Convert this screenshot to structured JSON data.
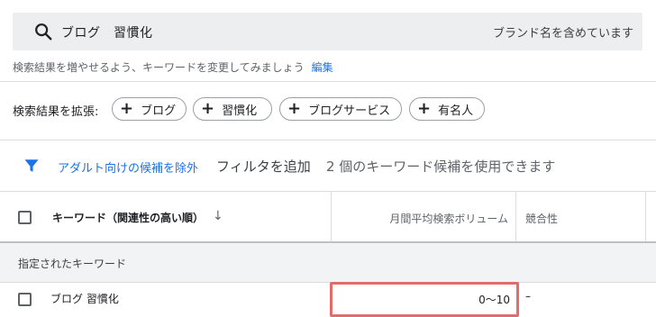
{
  "search": {
    "query": "ブログ　習慣化",
    "brand_note": "ブランド名を含めています",
    "hint": "検索結果を増やせるよう、キーワードを変更してみましょう",
    "hint_link": "編集"
  },
  "expand": {
    "label": "検索結果を拡張:",
    "chips": [
      "ブログ",
      "習慣化",
      "ブログサービス",
      "有名人"
    ]
  },
  "filter": {
    "adult_filter": "アダルト向けの候補を除外",
    "add_filter": "フィルタを追加",
    "count_text": "2 個のキーワード候補を使用できます"
  },
  "table": {
    "headers": {
      "keyword": "キーワード（関連性の高い順）",
      "volume": "月間平均検索ボリューム",
      "competition": "競合性"
    },
    "sort_icon": "arrow-down-icon",
    "section_label": "指定されたキーワード",
    "rows": [
      {
        "keyword": "ブログ 習慣化",
        "volume": "0～10",
        "competition": "–"
      }
    ]
  },
  "colors": {
    "link": "#1a73e8",
    "highlight_border": "#e06c6c",
    "search_bg": "#eceef0",
    "section_bg": "#f1f3f4"
  }
}
